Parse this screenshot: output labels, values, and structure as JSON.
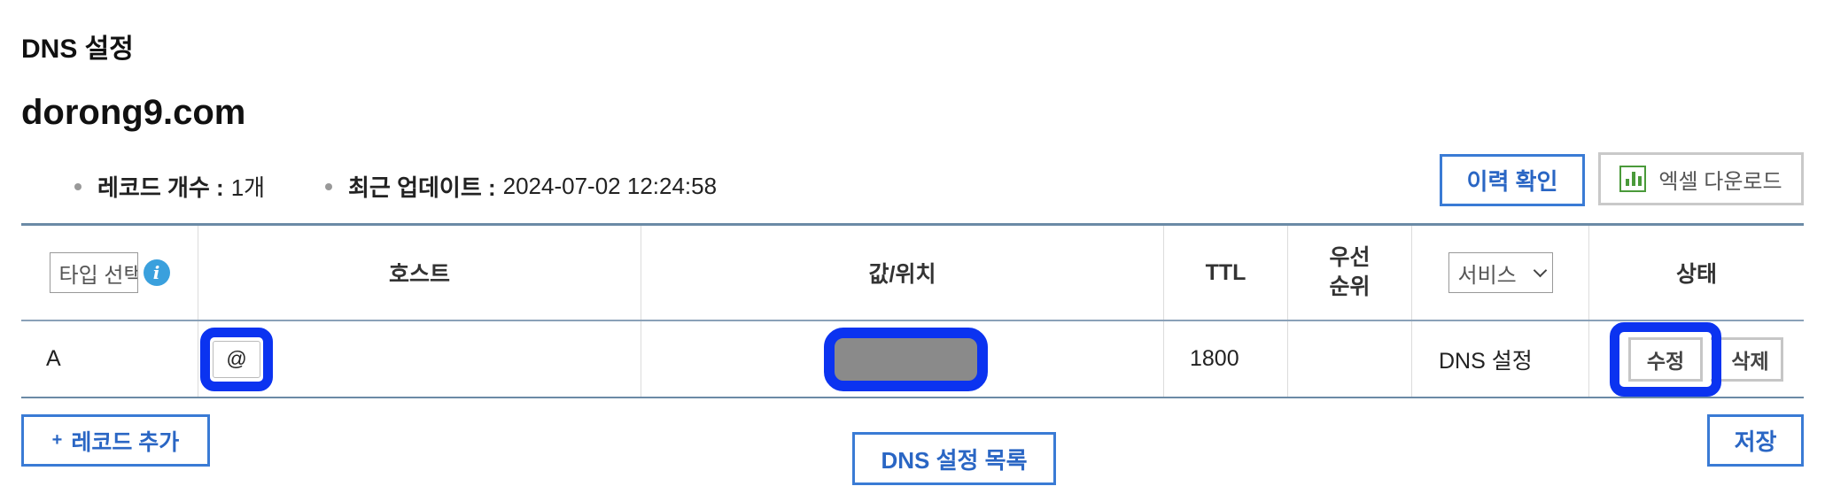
{
  "page": {
    "section_title": "DNS 설정",
    "domain": "dorong9.com"
  },
  "meta": {
    "record_count_label": "레코드 개수 :",
    "record_count_value": "1개",
    "last_update_label": "최근 업데이트 :",
    "last_update_value": "2024-07-02 12:24:58"
  },
  "toolbar": {
    "history_label": "이력 확인",
    "excel_label": "엑셀 다운로드",
    "excel_icon": "excel-chart-icon"
  },
  "table": {
    "headers": {
      "type_select": "타입 선택",
      "host": "호스트",
      "value": "값/위치",
      "ttl": "TTL",
      "priority_line1": "우선",
      "priority_line2": "순위",
      "service_select": "서비스",
      "status": "상태"
    },
    "rows": [
      {
        "type": "A",
        "host": "@",
        "value": "",
        "ttl": "1800",
        "priority": "",
        "service": "DNS 설정",
        "edit_label": "수정",
        "delete_label": "삭제"
      }
    ]
  },
  "footer": {
    "add_plus": "+",
    "add_label": "레코드 추가",
    "list_label": "DNS 설정 목록",
    "save_label": "저장"
  },
  "colors": {
    "accent": "#2a66c4",
    "highlight": "#0b33f0",
    "redacted": "#8a8a8a"
  }
}
